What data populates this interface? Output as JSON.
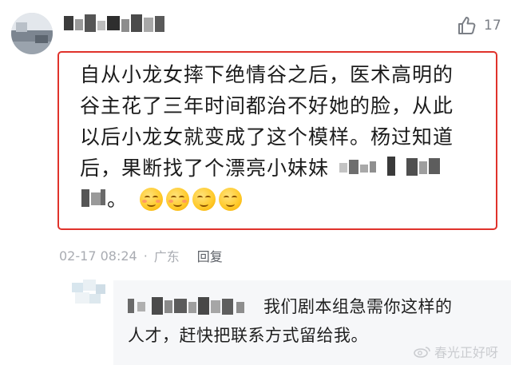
{
  "comment": {
    "like": {
      "icon": "thumbs-up-icon",
      "count": "17"
    },
    "text_lines": [
      "自从小龙女摔下绝情谷之后，医术高明的",
      "谷主花了三年时间都治不好她的脸，从此",
      "以后小龙女就变成了这个模样。杨过知道",
      "后，果断找了个漂亮小妹妹"
    ],
    "text_tail": "。",
    "emojis": [
      "blush-face-emoji",
      "blush-face-emoji",
      "smile-face-emoji",
      "smile-face-emoji"
    ],
    "date": "02-17 08:24",
    "separator": "·",
    "location": "广东",
    "reply_label": "回复",
    "highlight_color": "#e0322b"
  },
  "reply": {
    "text_line1": "我们剧本组急需你这样的",
    "text_line2": "人才，赶快把联系方式留给我。"
  },
  "watermark": {
    "text": "春光正好呀"
  }
}
